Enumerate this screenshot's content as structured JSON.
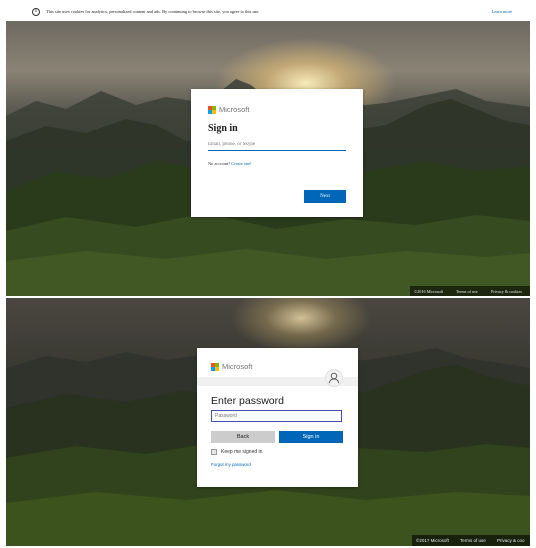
{
  "cookie_banner": {
    "text": "This site uses cookies for analytics, personalized content and ads. By continuing to browse this site, you agree to this use.",
    "learn_more": "Learn more"
  },
  "signin_card": {
    "brand": "Microsoft",
    "title": "Sign in",
    "email_placeholder": "Email, phone, or Skype",
    "no_account": "No account?",
    "create_link": "Create one!",
    "next_button": "Next"
  },
  "footer_top": {
    "copyright": "©2016 Microsoft",
    "terms": "Terms of use",
    "privacy": "Privacy & cookies"
  },
  "password_card": {
    "brand": "Microsoft",
    "title": "Enter password",
    "password_placeholder": "Password",
    "back_button": "Back",
    "signin_button": "Sign in",
    "keep_signed_in": "Keep me signed in",
    "keep_signed_in_checked": false,
    "forgot_link": "Forgot my password"
  },
  "footer_bottom": {
    "copyright": "©2017 Microsoft",
    "terms": "Terms of use",
    "privacy": "Privacy & coo"
  },
  "icons": {
    "info": "info-icon",
    "logo": "microsoft-logo-icon",
    "avatar": "user-avatar-icon"
  },
  "colors": {
    "accent": "#0067b8",
    "input_focus": "#3f51b5",
    "logo_red": "#f25022",
    "logo_green": "#7fba00",
    "logo_blue": "#00a4ef",
    "logo_yellow": "#ffb900"
  }
}
